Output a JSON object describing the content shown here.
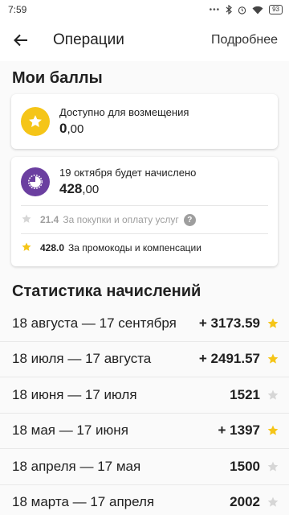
{
  "status_bar": {
    "time": "7:59",
    "battery": "93"
  },
  "header": {
    "title": "Операции",
    "details_link": "Подробнее"
  },
  "balances": {
    "title": "Мои баллы",
    "available": {
      "label": "Доступно для возмещения",
      "amount_int": "0",
      "amount_dec": ",00"
    },
    "pending": {
      "label": "19 октября будет начислено",
      "amount_int": "428",
      "amount_dec": ",00",
      "breakdown": [
        {
          "value": "21.4",
          "text": "За покупки и оплату услуг",
          "star": "grey-star-icon"
        },
        {
          "value": "428.0",
          "text": "За промокоды и компенсации",
          "star": "gold-star-icon"
        }
      ]
    }
  },
  "stats": {
    "title": "Статистика начислений",
    "rows": [
      {
        "period": "18 августа — 17 сентября",
        "value": "+ 3173.59",
        "star": "gold"
      },
      {
        "period": "18 июля — 17 августа",
        "value": "+ 2491.57",
        "star": "gold"
      },
      {
        "period": "18 июня — 17 июля",
        "value": "1521",
        "star": "grey"
      },
      {
        "period": "18 мая — 17 июня",
        "value": "+ 1397",
        "star": "gold"
      },
      {
        "period": "18 апреля — 17 мая",
        "value": "1500",
        "star": "grey"
      },
      {
        "period": "18 марта — 17 апреля",
        "value": "2002",
        "star": "grey"
      }
    ]
  },
  "colors": {
    "gold": "#f5c518",
    "grey_star": "#d6d6d6",
    "purple": "#6b3fa0"
  }
}
